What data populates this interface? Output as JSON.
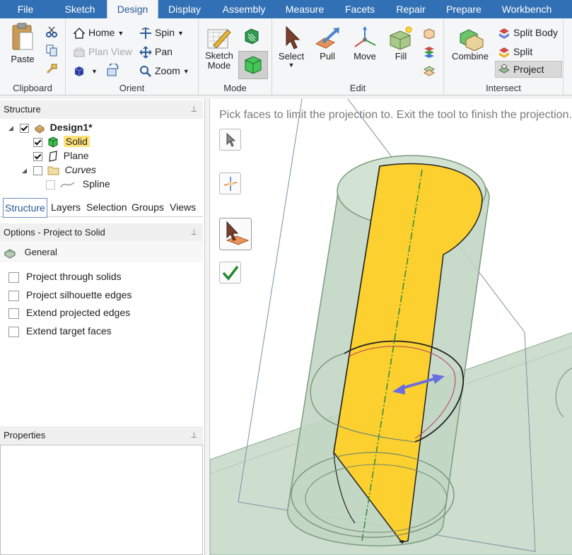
{
  "menu": {
    "tabs": [
      "File",
      "Sketch",
      "Design",
      "Display",
      "Assembly",
      "Measure",
      "Facets",
      "Repair",
      "Prepare",
      "Workbench"
    ],
    "active": "Design"
  },
  "ribbon": {
    "clipboard": {
      "label": "Clipboard",
      "paste": "Paste"
    },
    "orient": {
      "label": "Orient",
      "home": "Home",
      "plan_view": "Plan View",
      "spin": "Spin",
      "pan": "Pan",
      "zoom": "Zoom"
    },
    "mode": {
      "label": "Mode",
      "sketch_mode": "Sketch Mode"
    },
    "edit": {
      "label": "Edit",
      "select": "Select",
      "pull": "Pull",
      "move": "Move",
      "fill": "Fill"
    },
    "intersect": {
      "label": "Intersect",
      "combine": "Combine",
      "split_body": "Split Body",
      "split": "Split",
      "project": "Project"
    }
  },
  "structure": {
    "title": "Structure",
    "items": [
      {
        "label": "Design1*",
        "checked": true
      },
      {
        "label": "Solid",
        "checked": true
      },
      {
        "label": "Plane",
        "checked": true
      },
      {
        "label": "Curves",
        "checked": false
      },
      {
        "label": "Spline",
        "checked": false
      }
    ],
    "tabs": [
      "Structure",
      "Layers",
      "Selection",
      "Groups",
      "Views"
    ]
  },
  "options": {
    "title": "Options - Project to Solid",
    "section": "General",
    "items": [
      "Project through solids",
      "Project silhouette edges",
      "Extend projected edges",
      "Extend target faces"
    ]
  },
  "properties": {
    "title": "Properties"
  },
  "viewport": {
    "hint": "Pick faces to limit the projection to. Exit the tool to finish the projection."
  },
  "colors": {
    "accent": "#3170b4",
    "highlight": "#ffe27a",
    "solid_yellow": "#fcd02e",
    "cylinder_green": "#c9dcc9"
  }
}
